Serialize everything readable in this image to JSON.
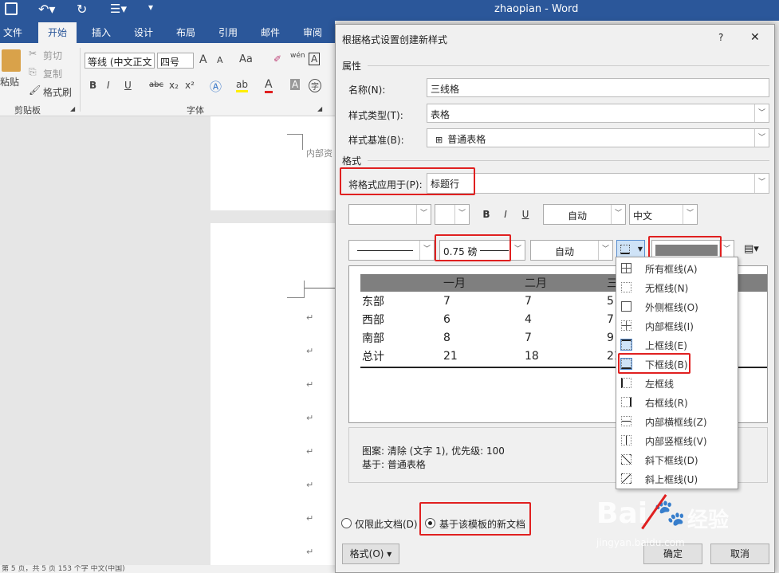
{
  "titlebar": {
    "title": "zhaopian - Word",
    "save_icon": "save-icon",
    "undo_icon": "undo-icon",
    "redo_icon": "redo-icon"
  },
  "tabs": [
    "文件",
    "开始",
    "插入",
    "设计",
    "布局",
    "引用",
    "邮件",
    "审阅"
  ],
  "ribbon": {
    "paste": "粘贴",
    "cut": "剪切",
    "copy": "复制",
    "format_painter": "格式刷",
    "clipboard_group": "剪贴板",
    "font_name": "等线 (中文正文",
    "font_size": "四号",
    "font_group": "字体",
    "grow": "A",
    "shrink": "A",
    "case": "Aa",
    "pinyin": "wén",
    "border_char": "A",
    "bold": "B",
    "italic": "I",
    "underline": "U",
    "strike": "abc",
    "sub": "x₂",
    "sup": "x²",
    "char_shade": "A",
    "enclose": "字"
  },
  "document": {
    "header_text": "内部资",
    "para_mark": "↵"
  },
  "statusbar": {
    "text": "第 5 页，共 5 页    153 个字        中文(中国)"
  },
  "dialog": {
    "title": "根据格式设置创建新样式",
    "help": "?",
    "close": "✕",
    "properties_label": "属性",
    "name_label": "名称(N):",
    "name_value": "三线格",
    "type_label": "样式类型(T):",
    "type_value": "表格",
    "based_label": "样式基准(B):",
    "based_value": "普通表格",
    "format_label": "格式",
    "apply_label": "将格式应用于(P):",
    "apply_value": "标题行",
    "font_color": "自动",
    "lang": "中文",
    "bold": "B",
    "italic": "I",
    "underline": "U",
    "line_weight": "0.75 磅",
    "border_color": "自动",
    "preview": {
      "headers": [
        "",
        "一月",
        "二月",
        "三"
      ],
      "rows": [
        [
          "东部",
          "7",
          "7",
          "5"
        ],
        [
          "西部",
          "6",
          "4",
          "7"
        ],
        [
          "南部",
          "8",
          "7",
          "9"
        ],
        [
          "总计",
          "21",
          "18",
          "21"
        ]
      ]
    },
    "desc_line1": "图案: 清除 (文字 1), 优先级: 100",
    "desc_line2": "基于: 普通表格",
    "radio_only": "仅限此文档(D)",
    "radio_template": "基于该模板的新文档",
    "format_btn": "格式(O) ▾",
    "ok": "确定",
    "cancel": "取消"
  },
  "border_menu": [
    "所有框线(A)",
    "无框线(N)",
    "外侧框线(O)",
    "内部框线(I)",
    "上框线(E)",
    "下框线(B)",
    "左框线",
    "右框线(R)",
    "内部横框线(Z)",
    "内部竖框线(V)",
    "斜下框线(D)",
    "斜上框线(U)"
  ],
  "watermark": {
    "brand": "Bai",
    "brand2": "经验",
    "url": "jingyan.baidu.com"
  },
  "colors": {
    "word_blue": "#2b579a",
    "highlight": "#e02020"
  }
}
